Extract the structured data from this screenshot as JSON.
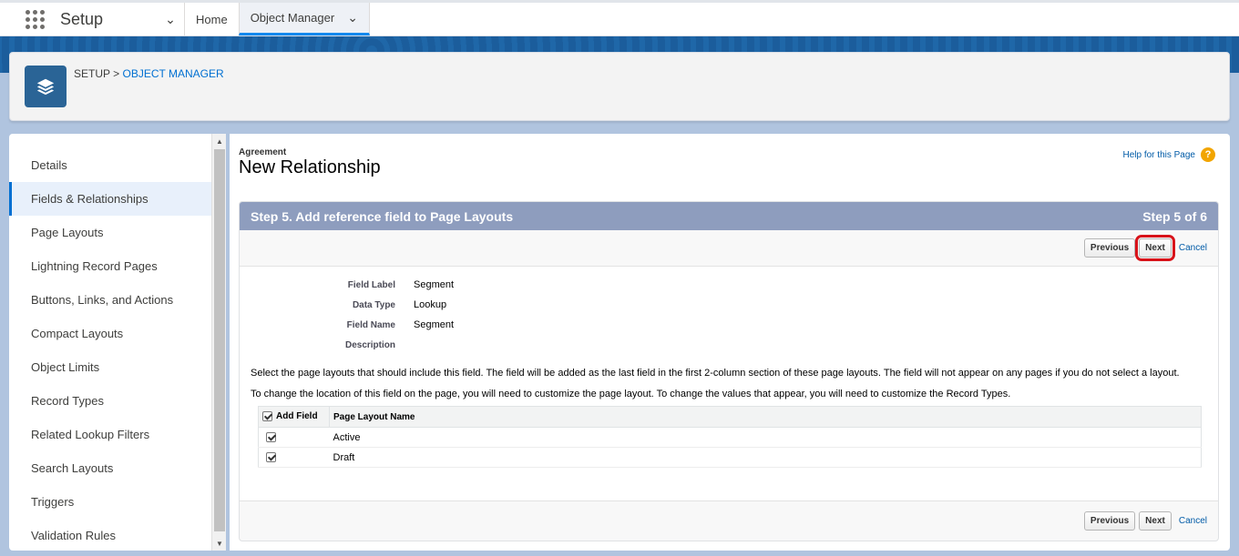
{
  "nav": {
    "app_name": "Setup",
    "tabs": [
      {
        "label": "Home"
      },
      {
        "label": "Object Manager"
      }
    ]
  },
  "header": {
    "breadcrumb_setup": "SETUP",
    "breadcrumb_sep": ">",
    "breadcrumb_object_manager": "OBJECT MANAGER"
  },
  "sidebar": {
    "items": [
      {
        "label": "Details"
      },
      {
        "label": "Fields & Relationships"
      },
      {
        "label": "Page Layouts"
      },
      {
        "label": "Lightning Record Pages"
      },
      {
        "label": "Buttons, Links, and Actions"
      },
      {
        "label": "Compact Layouts"
      },
      {
        "label": "Object Limits"
      },
      {
        "label": "Record Types"
      },
      {
        "label": "Related Lookup Filters"
      },
      {
        "label": "Search Layouts"
      },
      {
        "label": "Triggers"
      },
      {
        "label": "Validation Rules"
      }
    ],
    "active_index": 1
  },
  "main": {
    "object_name": "Agreement",
    "page_title": "New Relationship",
    "help_link": "Help for this Page",
    "help_icon": "?",
    "step_title": "Step 5. Add reference field to Page Layouts",
    "step_counter": "Step 5 of 6",
    "buttons": {
      "previous": "Previous",
      "next": "Next",
      "cancel": "Cancel"
    },
    "details": [
      {
        "label": "Field Label",
        "value": "Segment"
      },
      {
        "label": "Data Type",
        "value": "Lookup"
      },
      {
        "label": "Field Name",
        "value": "Segment"
      },
      {
        "label": "Description",
        "value": ""
      }
    ],
    "instruction_1": "Select the page layouts that should include this field. The field will be added as the last field in the first 2-column section of these page layouts. The field will not appear on any pages if you do not select a layout.",
    "instruction_2": "To change the location of this field on the page, you will need to customize the page layout. To change the values that appear, you will need to customize the Record Types.",
    "table": {
      "col_add": "Add Field",
      "col_name": "Page Layout Name",
      "rows": [
        {
          "name": "Active",
          "checked": true
        },
        {
          "name": "Draft",
          "checked": true
        }
      ]
    }
  },
  "colors": {
    "brand_blue": "#0070d2",
    "wizard_header": "#8e9dbe",
    "highlight_red": "#d8131a"
  }
}
